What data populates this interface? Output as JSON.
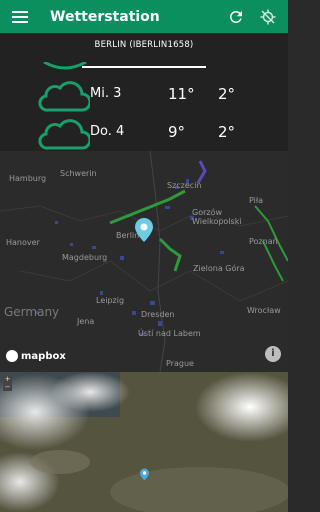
{
  "app": {
    "title": "Wetterstation"
  },
  "toolbar": {
    "menu_icon": "menu-icon",
    "refresh_icon": "refresh-icon",
    "location_off_icon": "location-off-icon"
  },
  "station": {
    "tab_label": "BERLIN (IBERLIN1658)"
  },
  "forecast": [
    {
      "day": "Mi. 3",
      "tmax": "11°",
      "tmin": "2°",
      "icon": "cloud-icon"
    },
    {
      "day": "Do. 4",
      "tmax": "9°",
      "tmin": "2°",
      "icon": "cloud-icon"
    }
  ],
  "map": {
    "cities": [
      "Hamburg",
      "Schwerin",
      "Szczecin",
      "Piła",
      "Gorzów Wielkopolski",
      "Hanover",
      "Berlin",
      "Poznań",
      "Magdeburg",
      "Zielona Góra",
      "Leipzig",
      "Germany",
      "Jena",
      "Dresden",
      "Wrocław",
      "Ústí nad Labem",
      "Prague"
    ],
    "attribution": "mapbox",
    "info_icon": "info-icon"
  },
  "colors": {
    "accent": "#0b8f5f",
    "panel": "#222222",
    "map_bg": "#2b2b2b"
  }
}
